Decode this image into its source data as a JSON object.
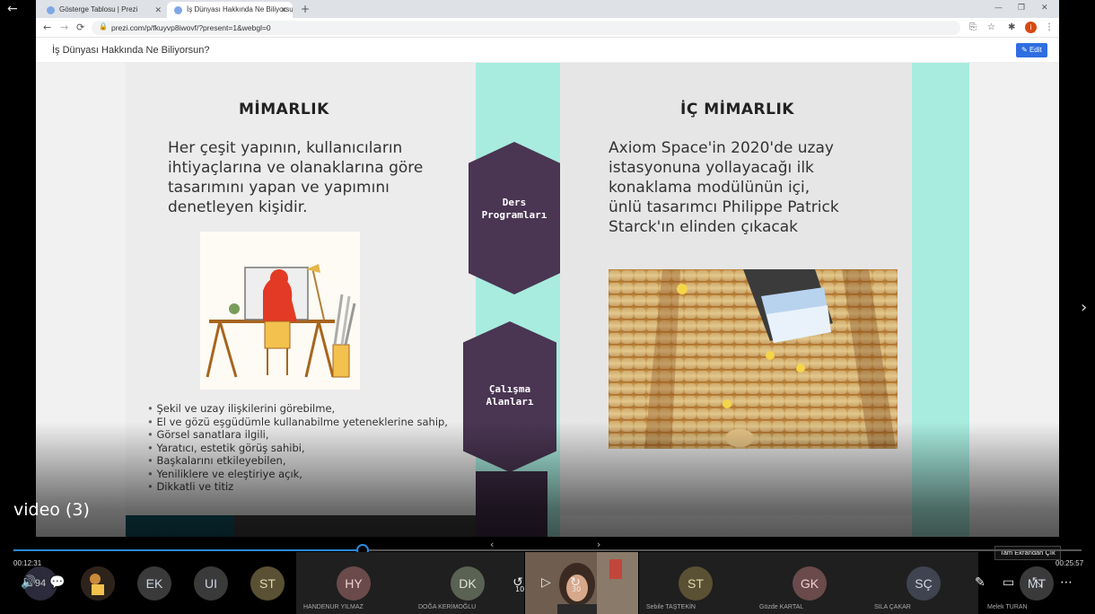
{
  "browser": {
    "tabs": [
      {
        "label": "Gösterge Tablosu | Prezi"
      },
      {
        "label": "İş Dünyası Hakkında Ne Biliyorsun?"
      }
    ],
    "url": "prezi.com/p/fkuyvp8iwovf/?present=1&webgl=0",
    "profile_initial": "i"
  },
  "prezi": {
    "title": "İş Dünyası Hakkında Ne Biliyorsun?",
    "edit_label": "Edit"
  },
  "slide": {
    "left": {
      "heading": "MİMARLIK",
      "desc_lines": [
        "Her çeşit yapının, kullanıcıların",
        "ihtiyaçlarına ve olanaklarına göre",
        "tasarımını yapan ve yapımını",
        "denetleyen kişidir."
      ],
      "bullets": [
        "Şekil ve uzay ilişkilerini görebilme,",
        "El ve gözü eşgüdümle kullanabilme yeteneklerine sahip,",
        "Görsel sanatlara ilgili,",
        "Yaratıcı, estetik görüş sahibi,",
        "Başkalarını etkileyebilen,",
        "Yeniliklere ve eleştiriye açık,",
        "Dikkatli ve titiz"
      ]
    },
    "center": {
      "top_hex": [
        "Ders",
        "Programları"
      ],
      "bottom_hex": [
        "Çalışma",
        "Alanları"
      ]
    },
    "right": {
      "heading": "İÇ MİMARLIK",
      "desc_lines": [
        "Axiom Space'in 2020'de uzay",
        "istasyonuna yollayacağı ilk",
        "konaklama modülünün içi,",
        "ünlü tasarımcı Philippe Patrick",
        "Starck'ın elinden çıkacak"
      ]
    }
  },
  "player": {
    "video_title": "video (3)",
    "time_current": "00:12:31",
    "time_total": "00:25:57",
    "progress_fraction": 0.327,
    "tooltip": "Tam Ekrandan Çık",
    "volume_value": "94",
    "skip_back": "10",
    "skip_forward": "30"
  },
  "participants": [
    {
      "initials": "EK",
      "name": ""
    },
    {
      "initials": "UI",
      "name": ""
    },
    {
      "initials": "ST",
      "name": ""
    },
    {
      "initials": "HY",
      "name": "HANDENUR YILMAZ"
    },
    {
      "initials": "DK",
      "name": "DOĞA KERİMOĞLU"
    },
    {
      "initials": "ST",
      "name": "Sebile TAŞTEKİN"
    },
    {
      "initials": "GK",
      "name": "Gözde KARTAL"
    },
    {
      "initials": "SÇ",
      "name": "SILA ÇAKAR"
    },
    {
      "initials": "MT",
      "name": "Melek TURAN"
    }
  ],
  "colors": {
    "teal": "#a8ecdf",
    "hex_purple": "#4a3552",
    "progress_blue": "#2b88d8",
    "edit_blue": "#2f6de1"
  }
}
